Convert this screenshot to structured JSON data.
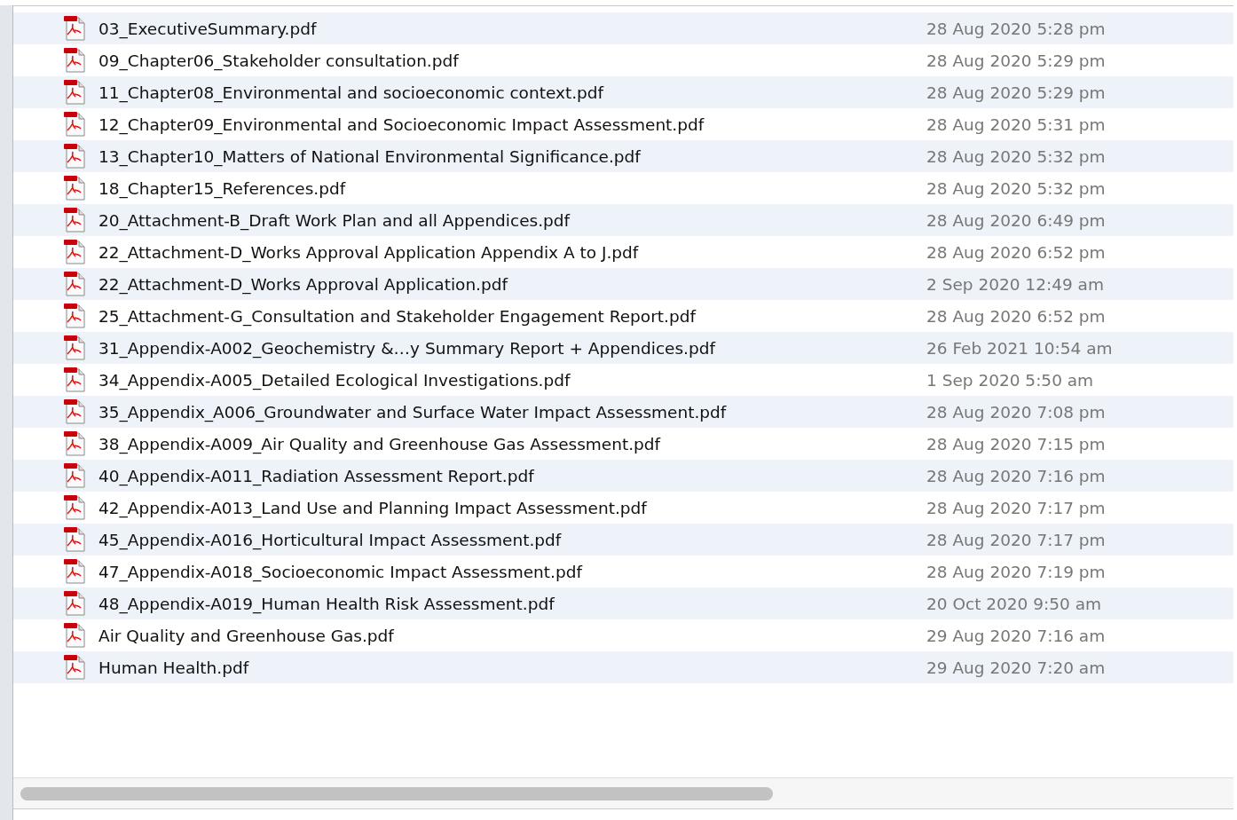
{
  "files": [
    {
      "name": "03_ExecutiveSummary.pdf",
      "modified": "28 Aug 2020 5:28 pm"
    },
    {
      "name": "09_Chapter06_Stakeholder consultation.pdf",
      "modified": "28 Aug 2020 5:29 pm"
    },
    {
      "name": "11_Chapter08_Environmental and socioeconomic context.pdf",
      "modified": "28 Aug 2020 5:29 pm"
    },
    {
      "name": "12_Chapter09_Environmental and Socioeconomic Impact Assessment.pdf",
      "modified": "28 Aug 2020 5:31 pm"
    },
    {
      "name": "13_Chapter10_Matters of National Environmental Significance.pdf",
      "modified": "28 Aug 2020 5:32 pm"
    },
    {
      "name": "18_Chapter15_References.pdf",
      "modified": "28 Aug 2020 5:32 pm"
    },
    {
      "name": "20_Attachment-B_Draft Work Plan and all Appendices.pdf",
      "modified": "28 Aug 2020 6:49 pm"
    },
    {
      "name": "22_Attachment-D_Works Approval Application Appendix A to J.pdf",
      "modified": "28 Aug 2020 6:52 pm"
    },
    {
      "name": "22_Attachment-D_Works Approval Application.pdf",
      "modified": "2 Sep 2020 12:49 am"
    },
    {
      "name": "25_Attachment-G_Consultation and Stakeholder Engagement Report.pdf",
      "modified": "28 Aug 2020 6:52 pm"
    },
    {
      "name": "31_Appendix-A002_Geochemistry &…y Summary Report + Appendices.pdf",
      "modified": "26 Feb 2021 10:54 am"
    },
    {
      "name": "34_Appendix-A005_Detailed Ecological Investigations.pdf",
      "modified": "1 Sep 2020 5:50 am"
    },
    {
      "name": "35_Appendix_A006_Groundwater and Surface Water Impact Assessment.pdf",
      "modified": "28 Aug 2020 7:08 pm"
    },
    {
      "name": "38_Appendix-A009_Air Quality and Greenhouse Gas Assessment.pdf",
      "modified": "28 Aug 2020 7:15 pm"
    },
    {
      "name": "40_Appendix-A011_Radiation Assessment Report.pdf",
      "modified": "28 Aug 2020 7:16 pm"
    },
    {
      "name": "42_Appendix-A013_Land Use and Planning Impact Assessment.pdf",
      "modified": "28 Aug 2020 7:17 pm"
    },
    {
      "name": "45_Appendix-A016_Horticultural Impact Assessment.pdf",
      "modified": "28 Aug 2020 7:17 pm"
    },
    {
      "name": "47_Appendix-A018_Socioeconomic Impact Assessment.pdf",
      "modified": "28 Aug 2020 7:19 pm"
    },
    {
      "name": "48_Appendix-A019_Human Health Risk Assessment.pdf",
      "modified": "20 Oct 2020 9:50 am"
    },
    {
      "name": "Air Quality and Greenhouse Gas.pdf",
      "modified": "29 Aug 2020 7:16 am"
    },
    {
      "name": "Human Health.pdf",
      "modified": "29 Aug 2020 7:20 am"
    }
  ]
}
